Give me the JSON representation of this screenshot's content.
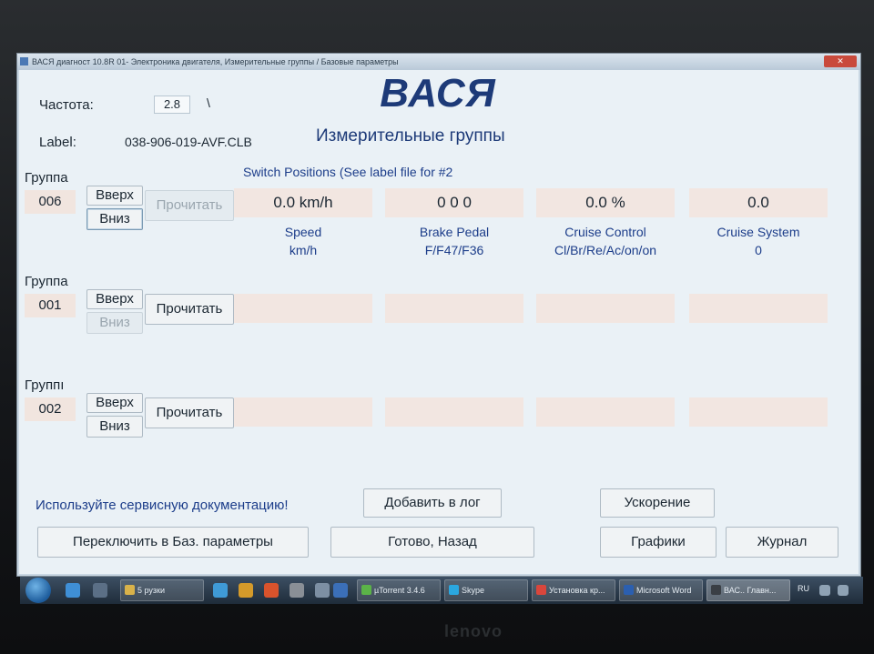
{
  "window": {
    "title": "ВАСЯ диагност 10.8R 01- Электроника двигателя, Измерительные группы / Базовые параметры",
    "close_label": "✕"
  },
  "header": {
    "freq_label": "Частота:",
    "freq_value": "2.8",
    "freq_tick": "\\",
    "label_label": "Label:",
    "label_value": "038-906-019-AVF.CLB",
    "logo": "ВАСЯ",
    "subtitle": "Измерительные группы"
  },
  "groups": [
    {
      "label": "Группа",
      "number": "006",
      "up": "Вверх",
      "down": "Вниз",
      "read": "Прочитать",
      "heading": "Switch Positions (See label file for #2",
      "fields": [
        {
          "value": "0.0 km/h",
          "name": "Speed",
          "unit": "km/h"
        },
        {
          "value": "0  0  0",
          "name": "Brake Pedal",
          "unit": "F/F47/F36"
        },
        {
          "value": "0.0 %",
          "name": "Cruise Control",
          "unit": "Cl/Br/Re/Ac/on/on"
        },
        {
          "value": "0.0",
          "name": "Cruise System",
          "unit": "0"
        }
      ]
    },
    {
      "label": "Группа",
      "number": "001",
      "up": "Вверх",
      "down": "Вниз",
      "read": "Прочитать"
    },
    {
      "label": "Группı",
      "number": "002",
      "up": "Вверх",
      "down": "Вниз",
      "read": "Прочитать"
    }
  ],
  "footer": {
    "service_text": "Используйте сервисную документацию!",
    "add_log": "Добавить в лог",
    "acceleration": "Ускорение",
    "switch_basic": "Переключить в Баз. параметры",
    "done_back": "Готово, Назад",
    "graphs": "Графики",
    "journal": "Журнал"
  },
  "taskbar": {
    "tasks": [
      "5 рузки",
      "µTorrent 3.4.6",
      "Skype",
      "Установка кр...",
      "Microsoft Word",
      "ВАС.. Главн..."
    ],
    "lang": "RU"
  },
  "device": {
    "brand": "lenovo"
  },
  "colors": {
    "accent": "#1d3a78",
    "field_bg": "#f2e6e1",
    "client_bg": "#eaf1f6"
  }
}
